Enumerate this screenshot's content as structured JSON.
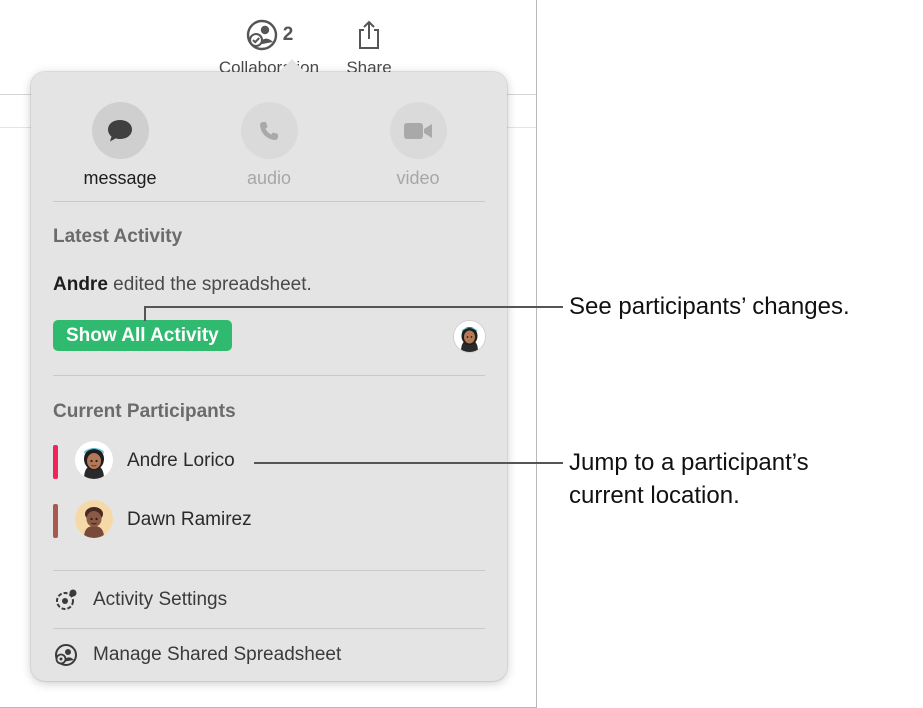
{
  "toolbar": {
    "collaboration": {
      "count": "2",
      "label": "Collaboration",
      "icon": "collaboration-icon"
    },
    "share": {
      "label": "Share",
      "icon": "share-icon"
    }
  },
  "popover": {
    "communication": [
      {
        "label": "message",
        "icon": "message-bubble-icon",
        "enabled": true
      },
      {
        "label": "audio",
        "icon": "phone-icon",
        "enabled": false
      },
      {
        "label": "video",
        "icon": "video-camera-icon",
        "enabled": false
      }
    ],
    "latest_activity": {
      "title": "Latest Activity",
      "actor": "Andre",
      "message": " edited the spreadsheet.",
      "button_label": "Show All Activity",
      "button_color": "#2fba70"
    },
    "current_participants": {
      "title": "Current Participants",
      "people": [
        {
          "name": "Andre Lorico",
          "color": "#f0245a"
        },
        {
          "name": "Dawn Ramirez",
          "color": "#a8584c"
        }
      ]
    },
    "menu": {
      "activity_settings": "Activity Settings",
      "manage_shared": "Manage Shared Spreadsheet"
    }
  },
  "callouts": {
    "changes": "See participants’ changes.",
    "location_line1": "Jump to a participant’s",
    "location_line2": "current location."
  }
}
